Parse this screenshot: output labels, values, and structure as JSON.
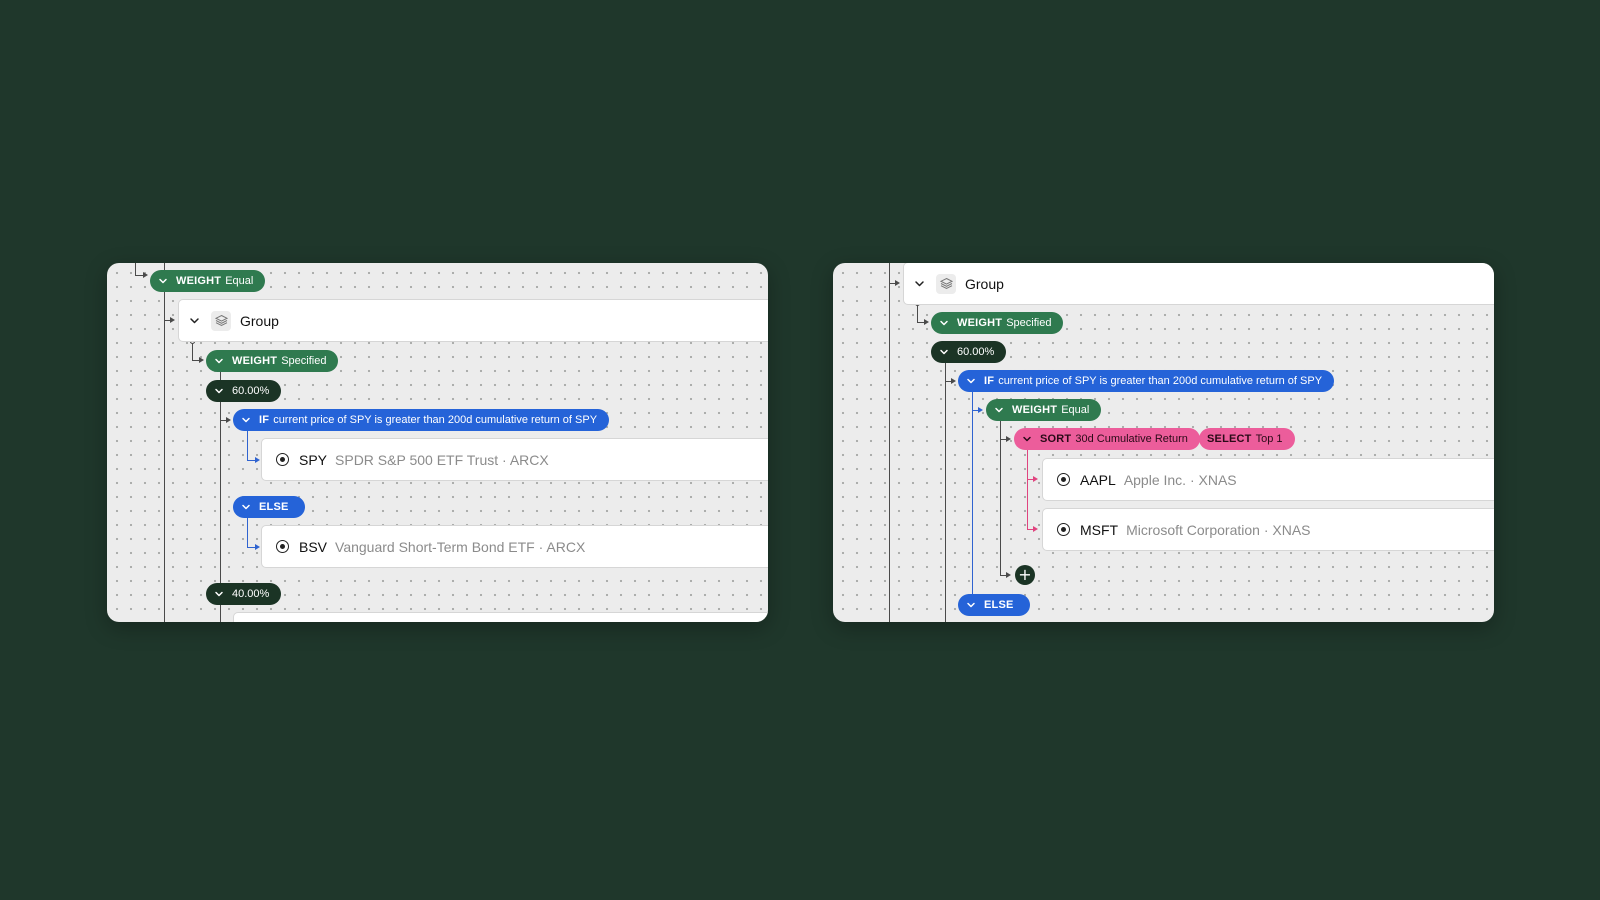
{
  "left": {
    "weight_equal": {
      "keyword": "WEIGHT",
      "value": "Equal"
    },
    "group": {
      "label": "Group"
    },
    "weight_specified": {
      "keyword": "WEIGHT",
      "value": "Specified"
    },
    "pct_60": "60.00%",
    "if_condition": {
      "keyword": "IF",
      "text": "current price of SPY is greater than 200d cumulative return of SPY"
    },
    "asset_spy": {
      "ticker": "SPY",
      "desc": "SPDR S&P 500 ETF Trust · ARCX"
    },
    "else": {
      "keyword": "ELSE"
    },
    "asset_bsv": {
      "ticker": "BSV",
      "desc": "Vanguard Short-Term Bond ETF · ARCX"
    },
    "pct_40": "40.00%"
  },
  "right": {
    "group": {
      "label": "Group"
    },
    "weight_specified": {
      "keyword": "WEIGHT",
      "value": "Specified"
    },
    "pct_60": "60.00%",
    "if_condition": {
      "keyword": "IF",
      "text": "current price of SPY is greater than 200d cumulative return of SPY"
    },
    "weight_equal": {
      "keyword": "WEIGHT",
      "value": "Equal"
    },
    "sort": {
      "keyword": "SORT",
      "value": "30d Cumulative Return"
    },
    "select": {
      "keyword": "SELECT",
      "value": "Top 1"
    },
    "asset_aapl": {
      "ticker": "AAPL",
      "desc": "Apple Inc. · XNAS"
    },
    "asset_msft": {
      "ticker": "MSFT",
      "desc": "Microsoft Corporation · XNAS"
    },
    "add_symbol": "+",
    "else": {
      "keyword": "ELSE"
    }
  },
  "icons": [
    "chevron-down-icon",
    "layers-icon",
    "radio-target-icon",
    "plus-icon"
  ],
  "colors": {
    "background": "#1f372b",
    "canvas": "#ececec",
    "weight_green": "#2f7a4f",
    "percent_dark": "#1b3425",
    "condition_blue": "#2563d8",
    "sort_pink": "#ec5d9b"
  }
}
